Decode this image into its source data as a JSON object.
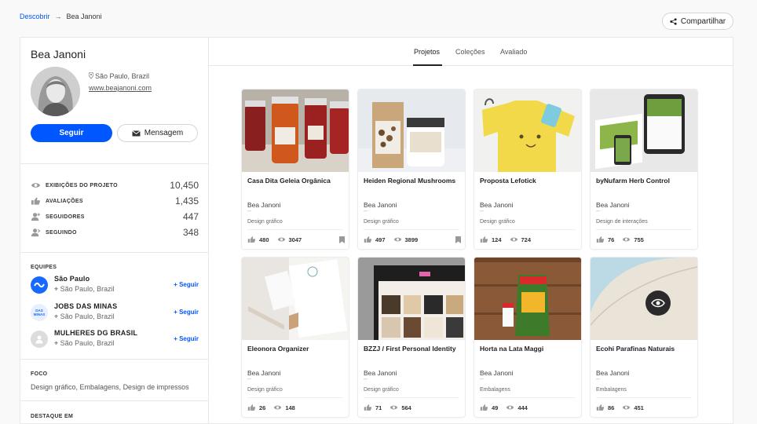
{
  "breadcrumb": {
    "link": "Descobrir",
    "current": "Bea Janoni"
  },
  "share_label": "Compartilhar",
  "profile": {
    "name": "Bea Janoni",
    "location": "São Paulo, Brazil",
    "website": "www.beajanoni.com",
    "follow_label": "Seguir",
    "message_label": "Mensagem",
    "stats": [
      {
        "label": "EXIBIÇÕES DO PROJETO",
        "value": "10,450",
        "icon": "eye-icon"
      },
      {
        "label": "AVALIAÇÕES",
        "value": "1,435",
        "icon": "thumbs-up-icon"
      },
      {
        "label": "SEGUIDORES",
        "value": "447",
        "icon": "user-add-icon"
      },
      {
        "label": "SEGUINDO",
        "value": "348",
        "icon": "user-follow-icon"
      }
    ],
    "teams_title": "EQUIPES",
    "teams": [
      {
        "name": "São Paulo",
        "location": "São Paulo, Brazil",
        "follow": "+ Seguir",
        "logo_color": "#1769ff"
      },
      {
        "name": "JOBS DAS MINAS",
        "location": "São Paulo, Brazil",
        "follow": "+ Seguir",
        "logo_text": "DAS MINAS",
        "logo_color": "#1769ff"
      },
      {
        "name": "MULHERES DG BRASIL",
        "location": "São Paulo, Brazil",
        "follow": "+ Seguir",
        "logo_color": "#d8d8d8"
      }
    ],
    "focus_title": "FOCO",
    "focus_text": "Design gráfico, Embalagens, Design de impressos",
    "featured_title": "DESTAQUE EM"
  },
  "tabs": [
    {
      "label": "Projetos",
      "active": true
    },
    {
      "label": "Coleções",
      "active": false
    },
    {
      "label": "Avaliado",
      "active": false
    }
  ],
  "projects": [
    {
      "title": "Casa Dita Geleia Orgânica",
      "owner": "Bea Janoni",
      "dash": "--",
      "field": "Design gráfico",
      "likes": "480",
      "views": "3047",
      "bookmark": true
    },
    {
      "title": "Heiden Regional Mushrooms",
      "owner": "Bea Janoni",
      "dash": "--",
      "field": "Design gráfico",
      "likes": "497",
      "views": "3899",
      "bookmark": true
    },
    {
      "title": "Proposta Lefotick",
      "owner": "Bea Janoni",
      "dash": "--",
      "field": "Design gráfico",
      "likes": "124",
      "views": "724",
      "bookmark": false
    },
    {
      "title": "byNufarm Herb Control",
      "owner": "Bea Janoni",
      "dash": "--",
      "field": "Design de interações",
      "likes": "76",
      "views": "755",
      "bookmark": false
    },
    {
      "title": "Eleonora Organizer",
      "owner": "Bea Janoni",
      "dash": "--",
      "field": "Design gráfico",
      "likes": "26",
      "views": "148",
      "bookmark": false
    },
    {
      "title": "BZZJ / First Personal Identity",
      "owner": "Bea Janoni",
      "dash": "--",
      "field": "Design gráfico",
      "likes": "71",
      "views": "564",
      "bookmark": false
    },
    {
      "title": "Horta na Lata Maggi",
      "owner": "Bea Janoni",
      "dash": "--",
      "field": "Embalagens",
      "likes": "49",
      "views": "444",
      "bookmark": false
    },
    {
      "title": "Ecohi Parafinas Naturais",
      "owner": "Bea Janoni",
      "dash": "--",
      "field": "Embalagens",
      "likes": "86",
      "views": "451",
      "bookmark": false
    }
  ],
  "colors": {
    "accent": "#0057ff"
  }
}
